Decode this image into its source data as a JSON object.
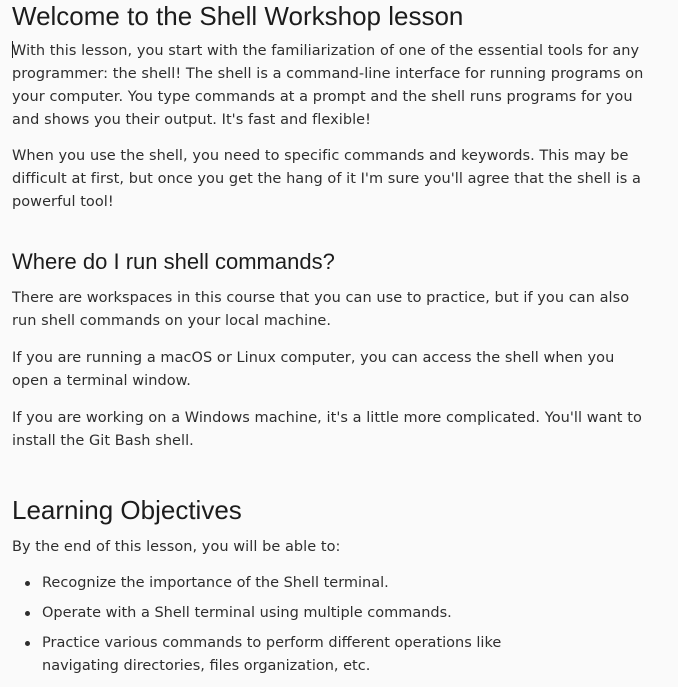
{
  "title": "Welcome to the Shell Workshop lesson",
  "intro": {
    "p1": "With this lesson, you start with the familiarization of one of the essential tools for any programmer: the shell! The shell is a command-line interface for running programs on your computer. You type commands at a prompt and the shell runs programs for you and shows you their output. It's fast and flexible!",
    "p2": "When you use the shell, you need to specific commands and keywords. This may be difficult at first, but once you get the hang of it I'm sure you'll agree that the shell is a powerful tool!"
  },
  "where": {
    "heading": "Where do I run shell commands?",
    "p1": "There are workspaces in this course that you can use to practice, but if you can also run shell commands on your local machine.",
    "p2": "If you are running a macOS or Linux computer, you can access the shell when you open a terminal window.",
    "p3": "If you are working on a Windows machine, it's a little more complicated. You'll want to install the Git Bash shell."
  },
  "objectives": {
    "heading": "Learning Objectives",
    "lead": "By the end of this lesson, you will be able to:",
    "items": [
      "Recognize the importance of the Shell terminal.",
      "Operate with a Shell terminal using multiple commands.",
      "Practice various commands to perform different operations like navigating directories, files organization, etc."
    ]
  }
}
